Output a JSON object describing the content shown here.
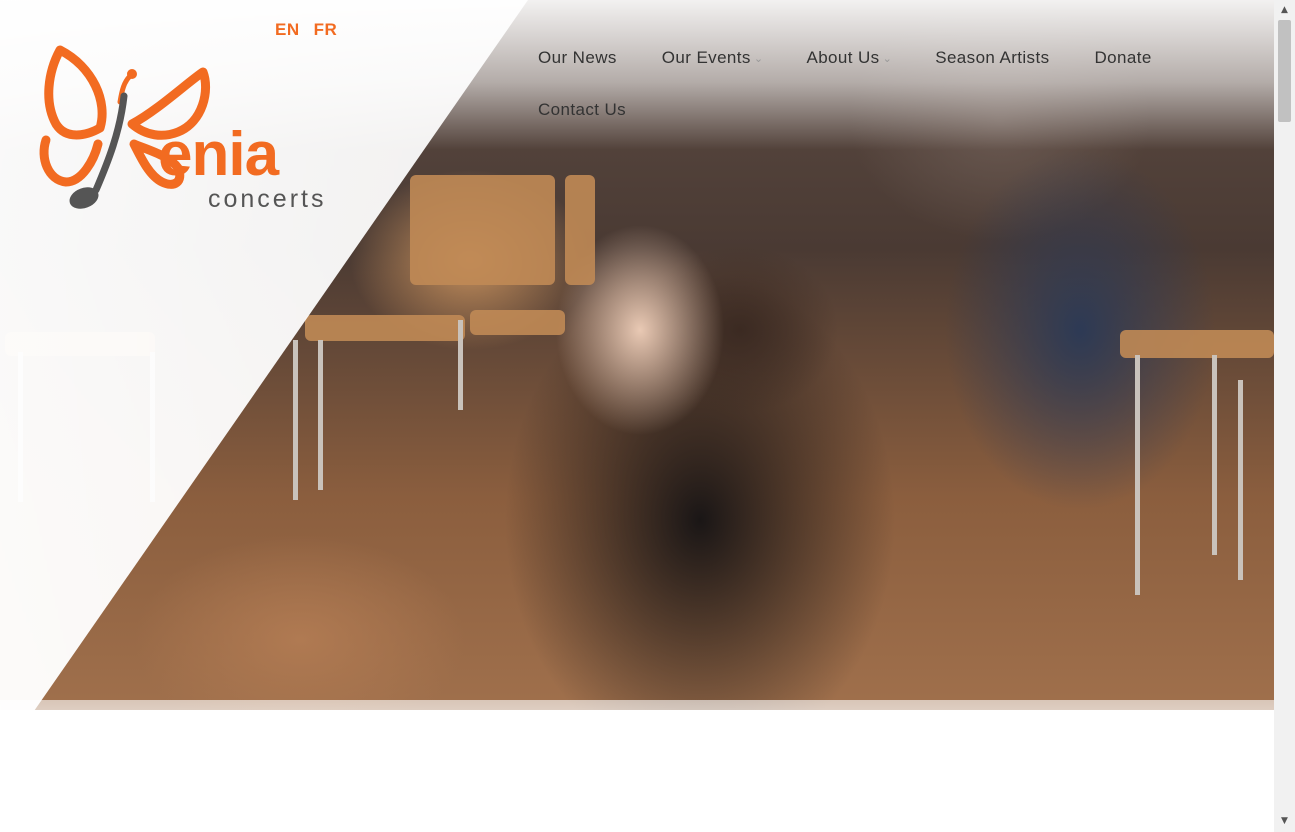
{
  "language": {
    "en": "EN",
    "fr": "FR"
  },
  "logo": {
    "word": "enia",
    "sub": "concerts"
  },
  "nav": {
    "items": [
      {
        "label": "Our News",
        "has_dropdown": false
      },
      {
        "label": "Our Events",
        "has_dropdown": true
      },
      {
        "label": "About Us",
        "has_dropdown": true
      },
      {
        "label": "Season Artists",
        "has_dropdown": false
      },
      {
        "label": "Donate",
        "has_dropdown": false
      }
    ],
    "contact": "Contact Us"
  },
  "colors": {
    "brand": "#f26b21",
    "text": "#333333",
    "logo_grey": "#555555"
  },
  "icons": {
    "dropdown": "chevron-down-icon",
    "scroll_up": "scroll-up-arrow-icon",
    "scroll_down": "scroll-down-arrow-icon"
  }
}
